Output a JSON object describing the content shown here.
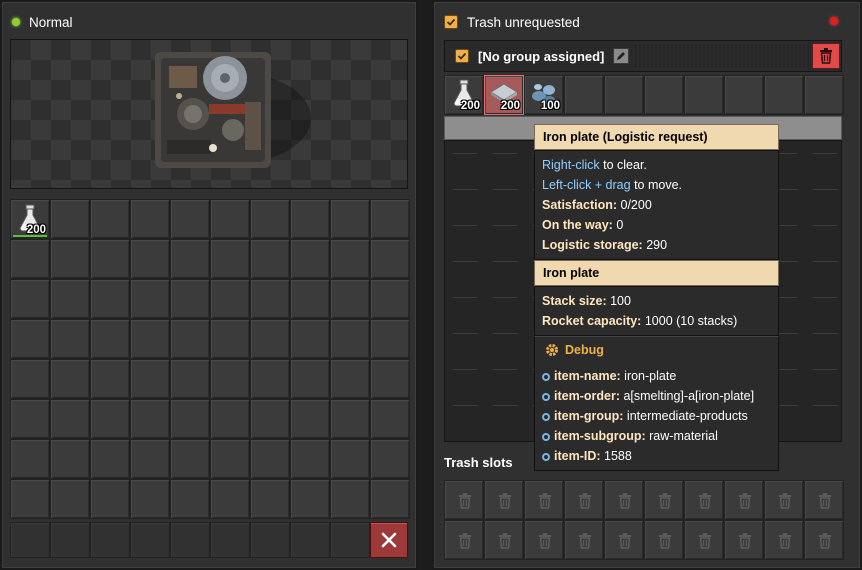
{
  "left": {
    "title": "Normal",
    "inventory": [
      {
        "item": "science-pack-icon",
        "count": "200"
      }
    ]
  },
  "right": {
    "title": "Trash unrequested",
    "group_label": "[No group assigned]",
    "requests": [
      {
        "item": "science-pack-icon",
        "count": "200"
      },
      {
        "item": "iron-plate-icon",
        "count": "200"
      },
      {
        "item": "iron-ore-icon",
        "count": "100"
      }
    ],
    "trash_slots_label": "Trash slots"
  },
  "tooltip": {
    "header": "Iron plate (Logistic request)",
    "right_click": "Right-click",
    "right_click_suffix": " to clear.",
    "left_click": "Left-click + drag",
    "left_click_suffix": " to move.",
    "satisfaction_label": "Satisfaction:",
    "satisfaction_value": " 0/200",
    "on_the_way_label": "On the way:",
    "on_the_way_value": " 0",
    "logistic_storage_label": "Logistic storage:",
    "logistic_storage_value": " 290",
    "item_header": "Iron plate",
    "stack_size_label": "Stack size:",
    "stack_size_value": " 100",
    "rocket_capacity_label": "Rocket capacity:",
    "rocket_capacity_value": " 1000 (10 stacks)",
    "debug_header": "Debug",
    "debug": [
      {
        "key": "item-name:",
        "value": " iron-plate"
      },
      {
        "key": "item-order:",
        "value": " a[smelting]-a[iron-plate]"
      },
      {
        "key": "item-group:",
        "value": " intermediate-products"
      },
      {
        "key": "item-subgroup:",
        "value": " raw-material"
      },
      {
        "key": "item-ID:",
        "value": " 1588"
      }
    ]
  },
  "colors": {
    "accent_orange": "#f0b048",
    "status_green": "#8fd02f",
    "status_red": "#e21d1d",
    "link_blue": "#8fd0ff"
  }
}
